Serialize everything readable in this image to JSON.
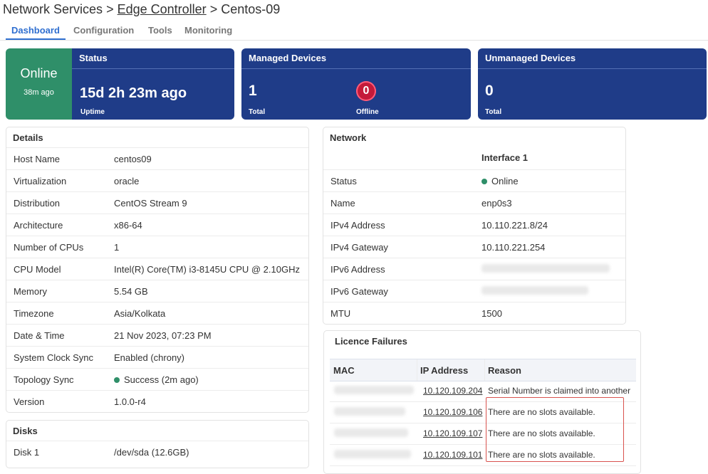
{
  "breadcrumb": {
    "root": "Network Services",
    "sep1": ">",
    "middle": "Edge Controller",
    "sep2": ">",
    "current": "Centos-09"
  },
  "tabs": [
    {
      "label": "Dashboard",
      "active": true
    },
    {
      "label": "Configuration",
      "active": false
    },
    {
      "label": "Tools",
      "active": false
    },
    {
      "label": "Monitoring",
      "active": false
    }
  ],
  "status_card": {
    "state": "Online",
    "ago": "38m ago",
    "title": "Status",
    "uptime_value": "15d 2h 23m ago",
    "uptime_label": "Uptime",
    "color": "#2f8f69"
  },
  "managed_card": {
    "title": "Managed Devices",
    "total": "1",
    "total_label": "Total",
    "offline": "0",
    "offline_label": "Offline",
    "color": "#1f3c88",
    "badge_color": "#c41a3a"
  },
  "unmanaged_card": {
    "title": "Unmanaged Devices",
    "total": "0",
    "total_label": "Total"
  },
  "details": {
    "title": "Details",
    "rows": [
      {
        "key": "Host Name",
        "value": "centos09"
      },
      {
        "key": "Virtualization",
        "value": "oracle"
      },
      {
        "key": "Distribution",
        "value": "CentOS Stream 9"
      },
      {
        "key": "Architecture",
        "value": "x86-64"
      },
      {
        "key": "Number of CPUs",
        "value": "1"
      },
      {
        "key": "CPU Model",
        "value": "Intel(R) Core(TM) i3-8145U CPU @ 2.10GHz"
      },
      {
        "key": "Memory",
        "value": "5.54 GB"
      },
      {
        "key": "Timezone",
        "value": "Asia/Kolkata"
      },
      {
        "key": "Date & Time",
        "value": "21 Nov 2023, 07:23 PM"
      },
      {
        "key": "System Clock Sync",
        "value": "Enabled (chrony)"
      },
      {
        "key": "Topology Sync",
        "value": "Success (2m ago)",
        "status": "success"
      },
      {
        "key": "Version",
        "value": "1.0.0-r4"
      }
    ]
  },
  "disks": {
    "title": "Disks",
    "rows": [
      {
        "key": "Disk 1",
        "value": "/dev/sda (12.6GB)"
      }
    ]
  },
  "network": {
    "title": "Network",
    "column": "Interface 1",
    "rows": [
      {
        "key": "Status",
        "value": "Online",
        "status": "online"
      },
      {
        "key": "Name",
        "value": "enp0s3"
      },
      {
        "key": "IPv4 Address",
        "value": "10.110.221.8/24"
      },
      {
        "key": "IPv4 Gateway",
        "value": "10.110.221.254"
      },
      {
        "key": "IPv6 Address",
        "value": "",
        "redacted": true
      },
      {
        "key": "IPv6 Gateway",
        "value": "",
        "redacted": true
      },
      {
        "key": "MTU",
        "value": "1500"
      }
    ]
  },
  "licence": {
    "title": "Licence Failures",
    "columns": [
      "MAC",
      "IP Address",
      "Reason"
    ],
    "rows": [
      {
        "mac": "",
        "ip": "10.120.109.204",
        "reason": "Serial Number is claimed into another"
      },
      {
        "mac": "",
        "ip": "10.120.109.106",
        "reason": "There are no slots available."
      },
      {
        "mac": "",
        "ip": "10.120.109.107",
        "reason": "There are no slots available."
      },
      {
        "mac": "",
        "ip": "10.120.109.101",
        "reason": "There are no slots available."
      }
    ]
  }
}
